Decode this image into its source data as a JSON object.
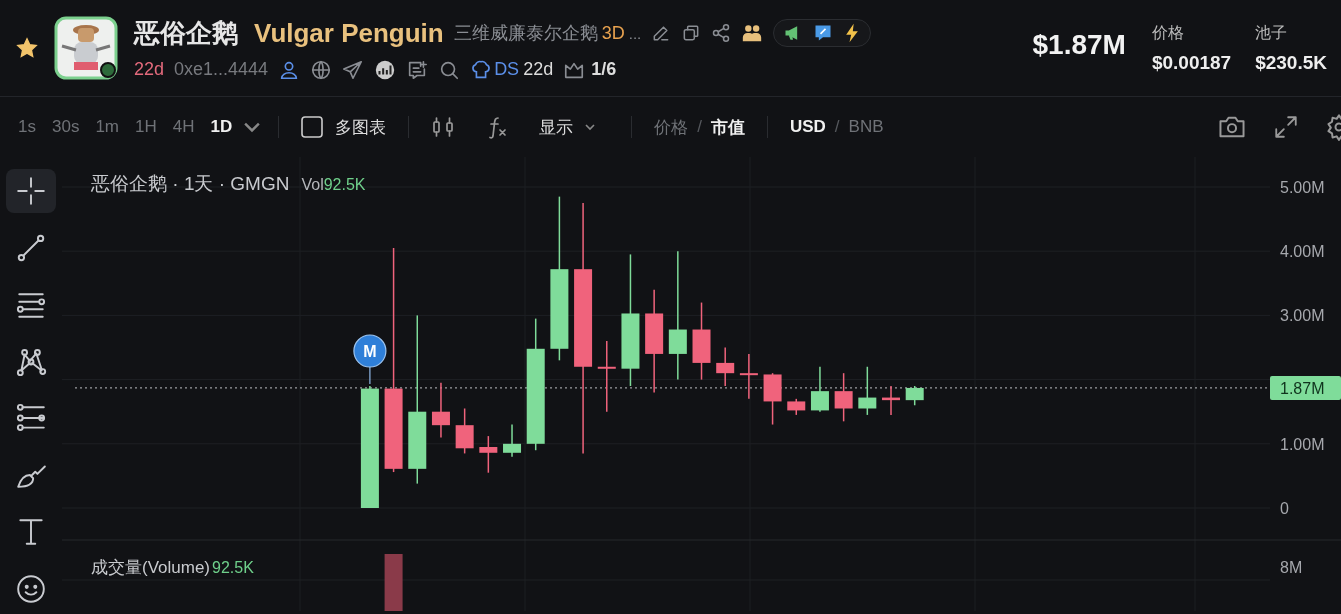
{
  "header": {
    "favorite": true,
    "name": "恶俗企鹅",
    "name_en": "Vulgar Penguin",
    "description": "三维威廉泰尔企鹅",
    "description_tag": "3D",
    "ellipsis": "...",
    "age": "22d",
    "address": "0xe1...4444",
    "ds_label": "DS",
    "ds_age": "22d",
    "holders_ratio": "1/6",
    "market_cap": "$1.87M",
    "stats": [
      {
        "label": "价格",
        "value": "$0.00187"
      },
      {
        "label": "池子",
        "value": "$230.5K"
      }
    ]
  },
  "toolbar": {
    "intervals": [
      {
        "label": "1s",
        "selected": false
      },
      {
        "label": "30s",
        "selected": false
      },
      {
        "label": "1m",
        "selected": false
      },
      {
        "label": "1H",
        "selected": false
      },
      {
        "label": "4H",
        "selected": false
      },
      {
        "label": "1D",
        "selected": true
      }
    ],
    "multi_chart": {
      "label": "多图表",
      "checked": false
    },
    "display": "显示",
    "separator": "/",
    "price_mode": [
      {
        "label": "价格",
        "selected": false
      },
      {
        "label": "市值",
        "selected": true
      }
    ],
    "currency": [
      {
        "label": "USD",
        "selected": true
      },
      {
        "label": "BNB",
        "selected": false
      }
    ]
  },
  "tools": [
    {
      "kind": "crosshair",
      "selected": true
    },
    {
      "kind": "trendline",
      "selected": false
    },
    {
      "kind": "parallel",
      "selected": false
    },
    {
      "kind": "pattern",
      "selected": false
    },
    {
      "kind": "fib",
      "selected": false
    },
    {
      "kind": "brush",
      "selected": false
    },
    {
      "kind": "text",
      "selected": false
    },
    {
      "kind": "emoji",
      "selected": false
    }
  ],
  "chart": {
    "legend": {
      "title": "恶俗企鹅 · 1天 · GMGN",
      "vol_label": "Vol",
      "vol_value": "92.5K"
    },
    "marker": "M",
    "last_price": "1.87M",
    "price_axis": [
      "5.00M",
      "4.00M",
      "3.00M",
      "1.00M",
      "0"
    ],
    "volume": {
      "label": "成交量(Volume)",
      "value": "92.5K",
      "axis_label": "8M"
    }
  }
}
